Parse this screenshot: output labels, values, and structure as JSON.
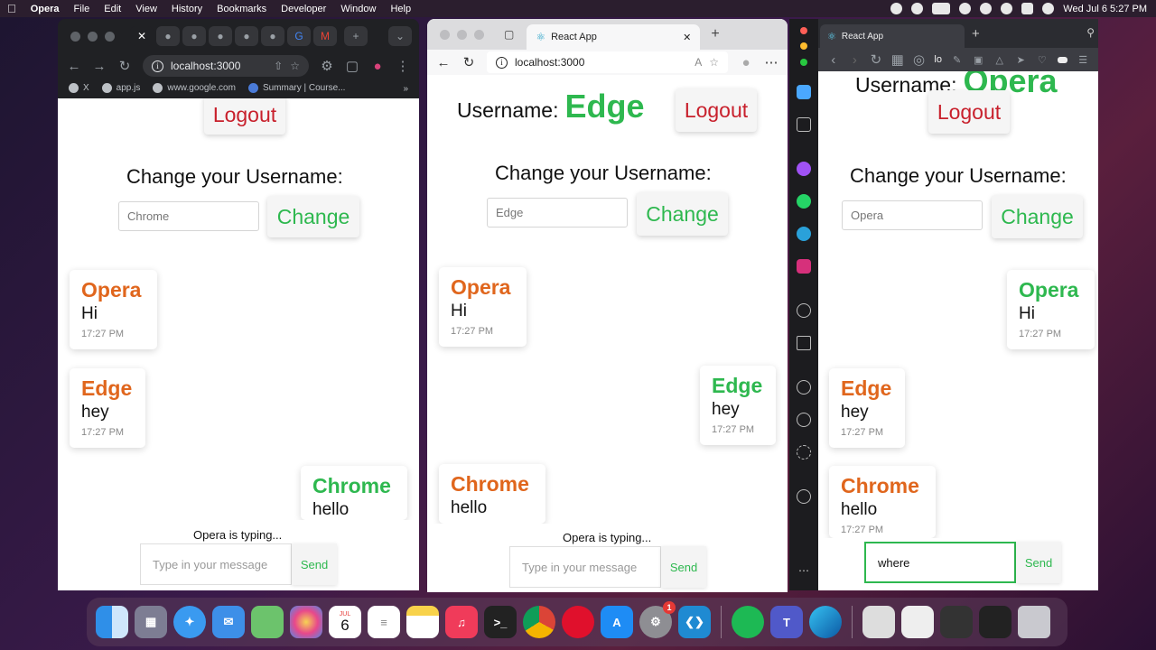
{
  "menubar": {
    "app_name": "Opera",
    "items": [
      "File",
      "Edit",
      "View",
      "History",
      "Bookmarks",
      "Developer",
      "Window",
      "Help"
    ],
    "datetime": "Wed Jul 6  5:27 PM"
  },
  "chrome_window": {
    "url": "localhost:3000",
    "bookmarks": [
      "X",
      "app.js",
      "www.google.com",
      "Summary | Course..."
    ],
    "logout_label": "Logout",
    "change_heading": "Change your Username:",
    "username_value": "Chrome",
    "change_label": "Change",
    "messages": [
      {
        "user": "Opera",
        "text": "Hi",
        "time": "17:27 PM"
      },
      {
        "user": "Edge",
        "text": "hey",
        "time": "17:27 PM"
      },
      {
        "user": "Chrome",
        "text": "hello",
        "time": ""
      }
    ],
    "typing_text": "Opera is typing...",
    "message_placeholder": "Type in your message",
    "send_label": "Send"
  },
  "edge_window": {
    "tab_title": "React App",
    "url": "localhost:3000",
    "username_label": "Username:",
    "username_name": "Edge",
    "logout_label": "Logout",
    "change_heading": "Change your Username:",
    "username_value": "Edge",
    "change_label": "Change",
    "messages": [
      {
        "user": "Opera",
        "text": "Hi",
        "time": "17:27 PM"
      },
      {
        "user": "Edge",
        "text": "hey",
        "time": "17:27 PM"
      },
      {
        "user": "Chrome",
        "text": "hello",
        "time": ""
      }
    ],
    "typing_text": "Opera is typing...",
    "message_placeholder": "Type in your message",
    "send_label": "Send"
  },
  "opera_window": {
    "tab_title": "React App",
    "url_fragment": "lo",
    "username_label": "Username:",
    "username_name": "Opera",
    "logout_label": "Logout",
    "change_heading": "Change your Username:",
    "username_value": "Opera",
    "change_label": "Change",
    "messages": [
      {
        "user": "Opera",
        "text": "Hi",
        "time": "17:27 PM"
      },
      {
        "user": "Edge",
        "text": "hey",
        "time": "17:27 PM"
      },
      {
        "user": "Chrome",
        "text": "hello",
        "time": "17:27 PM"
      }
    ],
    "message_value": "where",
    "send_label": "Send"
  },
  "dock": {
    "calendar_month": "JUL",
    "calendar_day": "6",
    "settings_badge": "1"
  },
  "colors": {
    "own_user": "#2eb84f",
    "other_user": "#e0661d",
    "logout": "#c8202c"
  }
}
